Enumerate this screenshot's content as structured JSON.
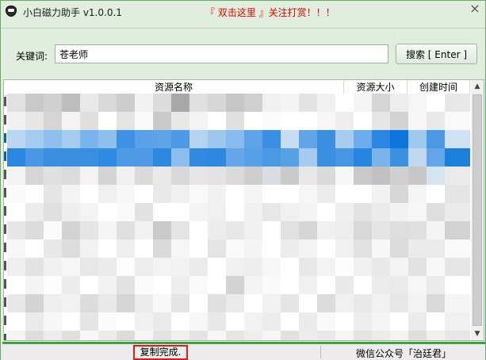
{
  "window": {
    "title": "小白磁力助手 v1.0.0.1",
    "promo": "『 双击这里 』关注打赏！！！",
    "close_glyph": "×"
  },
  "search": {
    "label": "关键词:",
    "value": "苍老师",
    "button_label": "搜索 [ Enter ]"
  },
  "table": {
    "columns": [
      "资源名称",
      "资源大小",
      "创建时间"
    ],
    "rows": [
      {
        "selected": false,
        "pixels": [
          "#e1e1e1",
          "#c9c9c9",
          "#d0d0d0",
          "#bdbdbd",
          "#e9e9e9",
          "#d9d9d9",
          "#cdcdcd",
          "#f2f2f2",
          "#dcdcdc",
          "#a8a8a8",
          "#e0e0e0",
          "#d7d7d7",
          "#c6c6c6",
          "#cfcfcf",
          "#f0f0f0",
          "#f4f4f4",
          "#e3e3e3",
          "#f1f1f1",
          "#ffffff",
          "#f5f5f5",
          "#d5d5d5",
          "#ededed",
          "#f6f6f6",
          "#ffffff",
          "#e8e8e8"
        ]
      },
      {
        "selected": false,
        "pixels": [
          "#f0f0f0",
          "#e6e6e6",
          "#d5d5d5",
          "#f3f3f3",
          "#dfdfdf",
          "#ffffff",
          "#e4e4e4",
          "#fafafa",
          "#c9c9c9",
          "#e7e7e7",
          "#f3f3f3",
          "#ffffff",
          "#e0e0e0",
          "#ffffff",
          "#fbfbfb",
          "#ffffff",
          "#ffffff",
          "#f7f7f7",
          "#eeeeee",
          "#ffffff",
          "#e6e6e6",
          "#d3d3d3",
          "#f7f7f7",
          "#e9e9e9",
          "#f9f9f9"
        ]
      },
      {
        "selected": true,
        "pixels": [
          "#b9d6f2",
          "#a5cbef",
          "#8fbfee",
          "#a6cdee",
          "#7ab4ec",
          "#8ebfed",
          "#3f92e3",
          "#5aa1e7",
          "#5ea3e8",
          "#4c9ae6",
          "#b5d4f0",
          "#9dc7ef",
          "#88bbee",
          "#5ea2e7",
          "#3b8fe2",
          "#c7ddf2",
          "#5fa5e8",
          "#3a8fe1",
          "#a8ccee",
          "#6faced",
          "#2a86e0",
          "#0e75dc",
          "#9ec9ef",
          "#4b98e4",
          "#cfe2f3"
        ]
      },
      {
        "selected": true,
        "pixels": [
          "#2a86e0",
          "#4997e5",
          "#3a8fe2",
          "#3b8fe2",
          "#3a8ee2",
          "#2f8be1",
          "#4e9ae5",
          "#4e9ae5",
          "#2d88e0",
          "#8bbeec",
          "#3389e1",
          "#2e88e1",
          "#66a6e8",
          "#55a0e6",
          "#4b99e5",
          "#56a0e6",
          "#a7cbf0",
          "#3a8fe2",
          "#4696e4",
          "#2586e0",
          "#7bb4eb",
          "#3c90e2",
          "#c0d9f1",
          "#63a5e8",
          "#1b7fde"
        ]
      },
      {
        "selected": false,
        "pixels": [
          "#f3f3f3",
          "#d6d6d6",
          "#e0e0e0",
          "#dbdbdb",
          "#f3f3f3",
          "#d4d4d4",
          "#f0f0f0",
          "#dadada",
          "#e9e9e9",
          "#d8d8d8",
          "#e6e6e6",
          "#e3e3e3",
          "#dadada",
          "#cecece",
          "#d8dde2",
          "#cacaca",
          "#e8e8e8",
          "#dadada",
          "#f7f7f7",
          "#c9c9c9",
          "#c1c1c1",
          "#d0d0d0",
          "#c7c7c7",
          "#d5e4f1",
          "#eaeaea"
        ]
      },
      {
        "selected": false,
        "pixels": [
          "#fafafa",
          "#ffffff",
          "#e5e5e5",
          "#f4f4f4",
          "#ffffff",
          "#f0f0f0",
          "#f7f7f7",
          "#ffffff",
          "#e9e9e9",
          "#f0f0f0",
          "#f9f9f9",
          "#f1f1f1",
          "#ffffff",
          "#f5f5f5",
          "#ffffff",
          "#ffffff",
          "#f6f6f6",
          "#ececec",
          "#ffffff",
          "#ffffff",
          "#f2f2f2",
          "#d7d7d7",
          "#f5f5f5",
          "#ffffff",
          "#e5e5e5"
        ]
      },
      {
        "selected": false,
        "pixels": [
          "#ffffff",
          "#ececec",
          "#e0e0e0",
          "#eeeeee",
          "#f3f3f3",
          "#ffffff",
          "#fafafa",
          "#e2e2e2",
          "#ffffff",
          "#ffffff",
          "#f3f3f3",
          "#f0f0f0",
          "#ffffff",
          "#f1f1f1",
          "#e7e7e7",
          "#f0f0f0",
          "#f4f4f4",
          "#ffffff",
          "#efefef",
          "#e3e3e3",
          "#ebebeb",
          "#f2f2f2",
          "#f6f6f6",
          "#dedede",
          "#ebebeb"
        ]
      },
      {
        "selected": false,
        "pixels": [
          "#e6e6e6",
          "#dcdcdc",
          "#fbfbfb",
          "#d3d3d3",
          "#e5e5e5",
          "#f5f5f5",
          "#e0e0e0",
          "#f2f2f2",
          "#c9c9c9",
          "#e4e4e4",
          "#ffffff",
          "#ececec",
          "#e7e7e7",
          "#f1f1f1",
          "#ffffff",
          "#e2e2e2",
          "#d6d6d6",
          "#f0f0f0",
          "#ededed",
          "#d8d8d8",
          "#e5e5e5",
          "#dedede",
          "#e0e0e0",
          "#f4f4f4",
          "#d2d2d2"
        ]
      },
      {
        "selected": false,
        "pixels": [
          "#f7f7f7",
          "#ffffff",
          "#e8e8e8",
          "#dddddd",
          "#f2f2f2",
          "#ffffff",
          "#efefef",
          "#ffffff",
          "#dadada",
          "#f6f6f6",
          "#ffffff",
          "#e4e4e4",
          "#fafafa",
          "#f4f4f4",
          "#ffffff",
          "#ececec",
          "#f3f3f3",
          "#ffffff",
          "#f0f0f0",
          "#e1e1e1",
          "#f7f7f7",
          "#dcdcdc",
          "#ebebeb",
          "#eaeaea",
          "#fafafa"
        ]
      },
      {
        "selected": false,
        "pixels": [
          "#efefef",
          "#e3e3e3",
          "#f1f1f1",
          "#f7f7f7",
          "#e7e7e7",
          "#ebebeb",
          "#fcfcfc",
          "#ededed",
          "#f3f3f3",
          "#f2f2f2",
          "#ebebeb",
          "#ffffff",
          "#f1f1f1",
          "#eeeeee",
          "#f7f7f7",
          "#ffffff",
          "#e8e8e8",
          "#f3f3f3",
          "#fdfdfd",
          "#f1f1f1",
          "#e9e9e9",
          "#f4f4f4",
          "#e2e2e2",
          "#f8f8f8",
          "#e6e6e6"
        ]
      },
      {
        "selected": false,
        "pixels": [
          "#ffffff",
          "#f4f4f4",
          "#fdfdfd",
          "#ececec",
          "#ffffff",
          "#f2f2f2",
          "#e2e2e2",
          "#fbfbfb",
          "#ffffff",
          "#eeeeee",
          "#f9f9f9",
          "#ffffff",
          "#d3d3d3",
          "#f3f3f3",
          "#fafafa",
          "#ffffff",
          "#f1f1f1",
          "#ffffff",
          "#e9e9e9",
          "#ffffff",
          "#ececec",
          "#eaeaea",
          "#f6f6f6",
          "#ebebeb",
          "#ffffff"
        ]
      },
      {
        "selected": false,
        "pixels": [
          "#e8e8e8",
          "#d4d4d4",
          "#efefef",
          "#f2f2f2",
          "#dcdcdc",
          "#e9e9e9",
          "#d5d5d5",
          "#ececec",
          "#f8f8f8",
          "#e5e5e5",
          "#ffffff",
          "#e0e0e0",
          "#eaeaea",
          "#ffffff",
          "#f2f2f2",
          "#e5e5e5",
          "#ffffff",
          "#dcdcdc",
          "#f0f0f0",
          "#e9e9e9",
          "#f2f2f2",
          "#e7e7e7",
          "#f3f3f3",
          "#dadada",
          "#f5f5f5"
        ]
      },
      {
        "selected": false,
        "pixels": [
          "#ffffff",
          "#ebebeb",
          "#f7f7f7",
          "#ffffff",
          "#e5e5e5",
          "#fbfbfb",
          "#ffffff",
          "#f0f0f0",
          "#eaeaea",
          "#ffffff",
          "#f7f7f7",
          "#e8e8e8",
          "#ffffff",
          "#f2f2f2",
          "#ececec",
          "#ffffff",
          "#ebebeb",
          "#f9f9f9",
          "#ffffff",
          "#ededed",
          "#f5f5f5",
          "#ffffff",
          "#ebebeb",
          "#ffffff",
          "#f0f0f0"
        ]
      },
      {
        "selected": false,
        "pixels": [
          "#f4f4f4",
          "#dedede",
          "#ededed",
          "#e0e0e0",
          "#f8f8f8",
          "#ececec",
          "#dcdcdc",
          "#f6f6f6",
          "#e3e3e3",
          "#f0f0f0",
          "#e4e4e4",
          "#f7f7f7",
          "#e6e6e6",
          "#eeeeee",
          "#f6f6f6",
          "#e1e1e1",
          "#ededed",
          "#e9e9e9",
          "#f6f6f6",
          "#e4e4e4",
          "#ececec",
          "#f4f4f4",
          "#dfdfdf",
          "#f0f0f0",
          "#e7e7e7"
        ]
      }
    ]
  },
  "status": {
    "message": "复制完成.",
    "right_text": "微信公众号「治廷君」"
  },
  "colors": {
    "accent_green": "#3ca142",
    "highlight_red": "#e01b1b",
    "promo_red": "#e00000",
    "window_bg": "#dfeedd"
  }
}
